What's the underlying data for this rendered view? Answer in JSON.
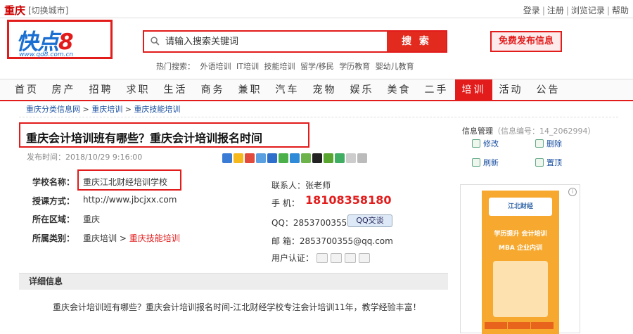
{
  "topbar": {
    "city": "重庆",
    "switch_city": "[切换城市]",
    "links": [
      "登录",
      "注册",
      "浏览记录",
      "帮助"
    ]
  },
  "logo": {
    "mark_a": "快点",
    "mark_b": "8",
    "url": "www.qd8.com.cn"
  },
  "search": {
    "placeholder": "请输入搜索关键词",
    "button": "搜 索"
  },
  "publish_button": "免费发布信息",
  "hot_search": {
    "label": "热门搜索：",
    "terms": [
      "外语培训",
      "IT培训",
      "技能培训",
      "留学/移民",
      "学历教育",
      "婴幼儿教育"
    ]
  },
  "nav": {
    "items": [
      "首页",
      "房产",
      "招聘",
      "求职",
      "生活",
      "商务",
      "兼职",
      "汽车",
      "宠物",
      "娱乐",
      "美食",
      "二手",
      "培训",
      "活动",
      "公告"
    ],
    "active_index": 12
  },
  "breadcrumb": [
    "重庆分类信息网",
    "重庆培训",
    "重庆技能培训"
  ],
  "article": {
    "title": "重庆会计培训班有哪些？重庆会计培训报名时间",
    "publish_time": "发布时间：2018/10/29 9:16:00",
    "school_label": "学校名称：",
    "school_value": "重庆江北财经培训学校",
    "method_label": "授课方式：",
    "method_value": "http://www.jbcjxx.com",
    "area_label": "所在区域：",
    "area_value": "重庆",
    "category_label": "所属类别：",
    "category_value_a": "重庆培训",
    "category_sep": " > ",
    "category_value_b": "重庆技能培训"
  },
  "contact": {
    "person": "联系人：张老师",
    "phone_label": "手  机：",
    "phone": "18108358180",
    "qq": "QQ：2853700355",
    "qq_button": "QQ交谈",
    "email": "邮  箱：2853700355@qq.com",
    "verify_label": "用户认证："
  },
  "detail": {
    "heading": "详细信息",
    "text": "重庆会计培训班有哪些？重庆会计培训报名时间-江北财经学校专注会计培训11年，教学经验丰富！"
  },
  "side": {
    "head": "信息管理",
    "head_id": "（信息编号：14_2062994）",
    "links": [
      "修改",
      "删除",
      "刷新",
      "置顶"
    ]
  },
  "ad": {
    "logo_text": "江北财经",
    "line1": "学历提升  会计培训",
    "line2": "MBA  企业内训",
    "close": "i"
  }
}
